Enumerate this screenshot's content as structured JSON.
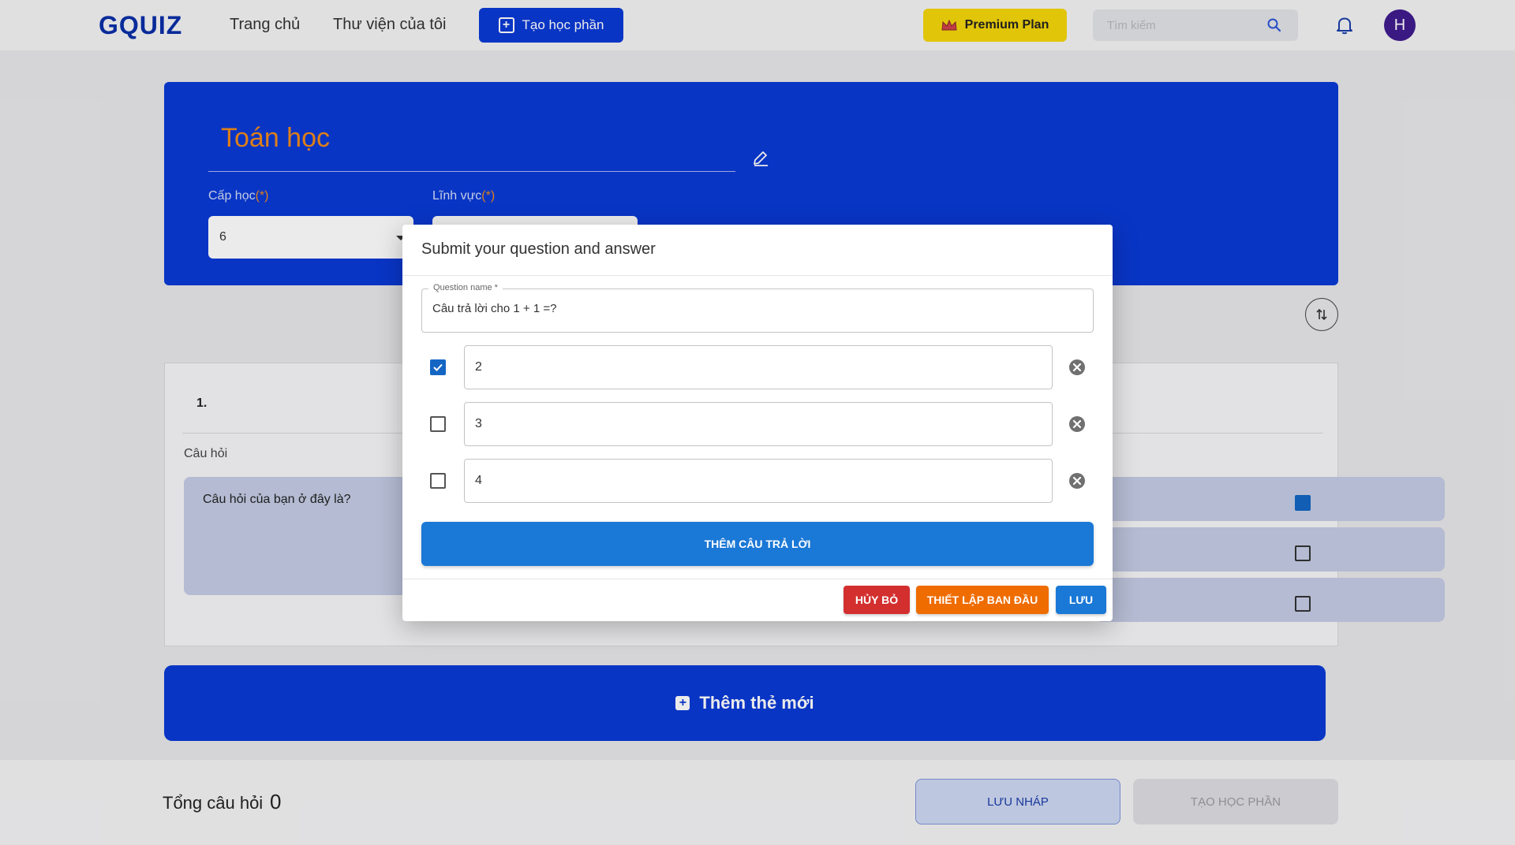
{
  "header": {
    "logo": "GQUIZ",
    "nav": [
      "Trang chủ",
      "Thư viện của tôi"
    ],
    "create_label": "Tạo học phần",
    "premium_label": "Premium Plan",
    "search_placeholder": "Tìm kiếm",
    "avatar_initial": "H"
  },
  "set": {
    "title": "Toán học",
    "level_label": "Cấp học",
    "field_label": "Lĩnh vực",
    "required_mark": "(*)",
    "level_value": "6"
  },
  "question_card": {
    "number": "1.",
    "question_label": "Câu hỏi",
    "question_placeholder": "Câu hỏi của bạn ở đây là?",
    "answers_checked": [
      true,
      false,
      false
    ]
  },
  "add_card_label": "Thêm thẻ mới",
  "footer": {
    "total_label": "Tổng câu hỏi",
    "total_count": "0",
    "draft_label": "LƯU NHÁP",
    "publish_label": "TẠO HỌC PHẦN"
  },
  "modal": {
    "title": "Submit your question and answer",
    "question_legend": "Question name *",
    "question_value": "Câu trả lời cho 1 + 1 =?",
    "answers": [
      {
        "value": "2",
        "correct": true
      },
      {
        "value": "3",
        "correct": false
      },
      {
        "value": "4",
        "correct": false
      }
    ],
    "add_answer_label": "THÊM CÂU TRẢ LỜI",
    "cancel_label": "HỦY BỎ",
    "reset_label": "THIẾT LẬP BAN ĐẦU",
    "save_label": "LƯU"
  },
  "colors": {
    "brand_blue": "#0a3ad6",
    "accent_orange": "#f08a1c",
    "premium_yellow": "#f5d60a",
    "checkbox_blue": "#1466c4",
    "danger_red": "#d32f2f",
    "warning_orange": "#ef6c00"
  }
}
